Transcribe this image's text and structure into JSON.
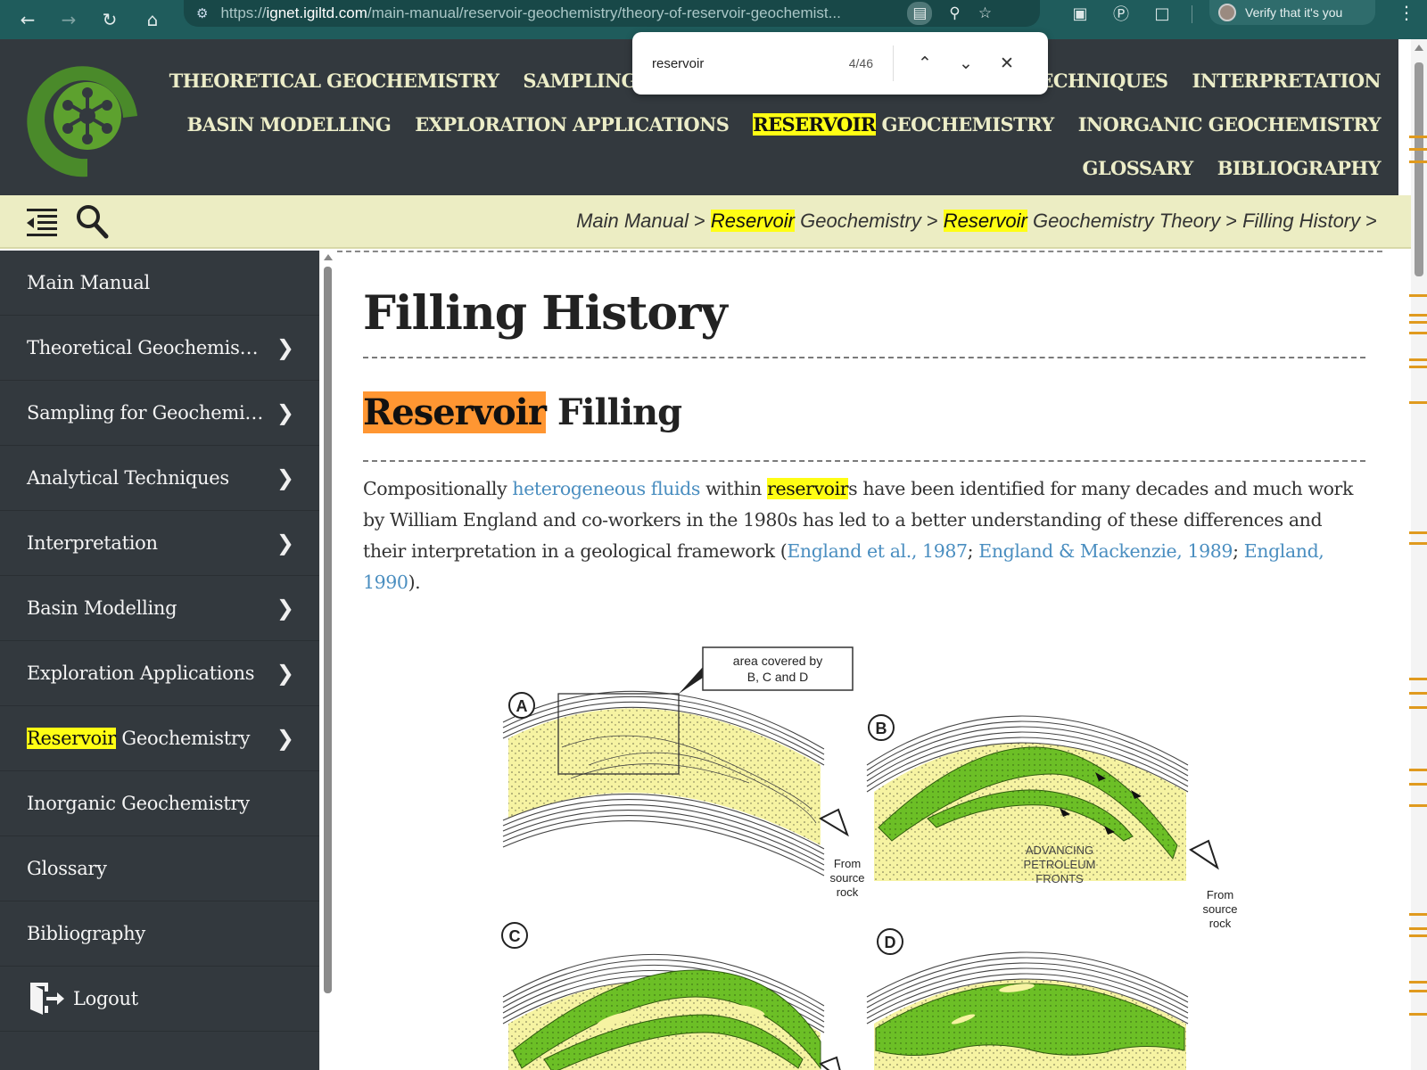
{
  "browser": {
    "url_prefix": "https://",
    "url_host": "ignet.igiltd.com",
    "url_path": "/main-manual/reservoir-geochemistry/theory-of-reservoir-geochemist...",
    "verify_label": "Verify that it's you",
    "icons": [
      "back-icon",
      "forward-icon",
      "reload-icon",
      "home-icon",
      "site-settings-icon",
      "zoom-icon",
      "star-icon",
      "extension-icon",
      "grammarly-icon",
      "puzzle-icon",
      "kebab-menu-icon"
    ]
  },
  "find": {
    "query": "reservoir",
    "count": "4/46"
  },
  "header": {
    "nav_rows": [
      [
        {
          "pre": "",
          "hl": "",
          "post": "THEORETICAL GEOCHEMISTRY"
        },
        {
          "pre": "",
          "hl": "",
          "post": "SAMPLING FOR GEOCHEMISTRY"
        },
        {
          "pre": "",
          "hl": "",
          "post": "ANALYTICAL TECHNIQUES"
        },
        {
          "pre": "",
          "hl": "",
          "post": "INTERPRETATION"
        }
      ],
      [
        {
          "pre": "",
          "hl": "",
          "post": "BASIN MODELLING"
        },
        {
          "pre": "",
          "hl": "",
          "post": "EXPLORATION APPLICATIONS"
        },
        {
          "pre": "",
          "hl": "RESERVOIR",
          "post": " GEOCHEMISTRY"
        },
        {
          "pre": "",
          "hl": "",
          "post": "INORGANIC GEOCHEMISTRY"
        }
      ],
      [
        {
          "pre": "",
          "hl": "",
          "post": "GLOSSARY"
        },
        {
          "pre": "",
          "hl": "",
          "post": "BIBLIOGRAPHY"
        }
      ]
    ]
  },
  "breadcrumb": {
    "items": [
      {
        "hl": "",
        "text": "Main Manual"
      },
      {
        "hl": "Reservoir",
        "text": " Geochemistry"
      },
      {
        "hl": "Reservoir",
        "text": " Geochemistry Theory"
      },
      {
        "hl": "",
        "text": "Filling History"
      }
    ],
    "separator": ">"
  },
  "sidebar": {
    "items": [
      {
        "hl": "",
        "label": "Main Manual",
        "chevron": false
      },
      {
        "hl": "",
        "label": "Theoretical Geochemis…",
        "chevron": true
      },
      {
        "hl": "",
        "label": "Sampling for Geochemi…",
        "chevron": true
      },
      {
        "hl": "",
        "label": "Analytical Techniques",
        "chevron": true
      },
      {
        "hl": "",
        "label": "Interpretation",
        "chevron": true
      },
      {
        "hl": "",
        "label": "Basin Modelling",
        "chevron": true
      },
      {
        "hl": "",
        "label": "Exploration Applications",
        "chevron": true
      },
      {
        "hl": "Reservoir",
        "label": " Geochemistry",
        "chevron": true
      },
      {
        "hl": "",
        "label": "Inorganic Geochemistry",
        "chevron": false
      },
      {
        "hl": "",
        "label": "Glossary",
        "chevron": false
      },
      {
        "hl": "",
        "label": "Bibliography",
        "chevron": false
      }
    ],
    "logout_label": "Logout"
  },
  "main": {
    "title": "Filling History",
    "section_hl": "Reservoir",
    "section_rest": " Filling",
    "paragraph": {
      "t1": "Compositionally ",
      "link1": "heterogeneous fluids",
      "t2": " within ",
      "hl": "reservoir",
      "t3": "s have been identified for many decades and much work by William England and co-workers in the 1980s has led to a better understanding of these differences and their interpretation in a geological framework (",
      "link2": "England et al., 1987",
      "t4": "; ",
      "link3": "England & Mackenzie, 1989",
      "t5": "; ",
      "link4": "England, 1990",
      "t6": ")."
    },
    "figure": {
      "callout": [
        "area covered by",
        "B, C and D"
      ],
      "panel_labels": [
        "A",
        "B",
        "C",
        "D"
      ],
      "source_label": [
        "From",
        "source",
        "rock"
      ],
      "fronts_label": [
        "ADVANCING",
        "PETROLEUM",
        "FRONTS"
      ]
    }
  },
  "colors": {
    "header_bg": "#33393e",
    "nav_text": "#ecedc8",
    "crumb_bg": "#ecedc3",
    "find_highlight": "#fffe14",
    "active_match": "#ff9632",
    "link": "#4a8ec0",
    "oil_green": "#6cbf26",
    "sand_yellow": "#f6f3a2"
  }
}
